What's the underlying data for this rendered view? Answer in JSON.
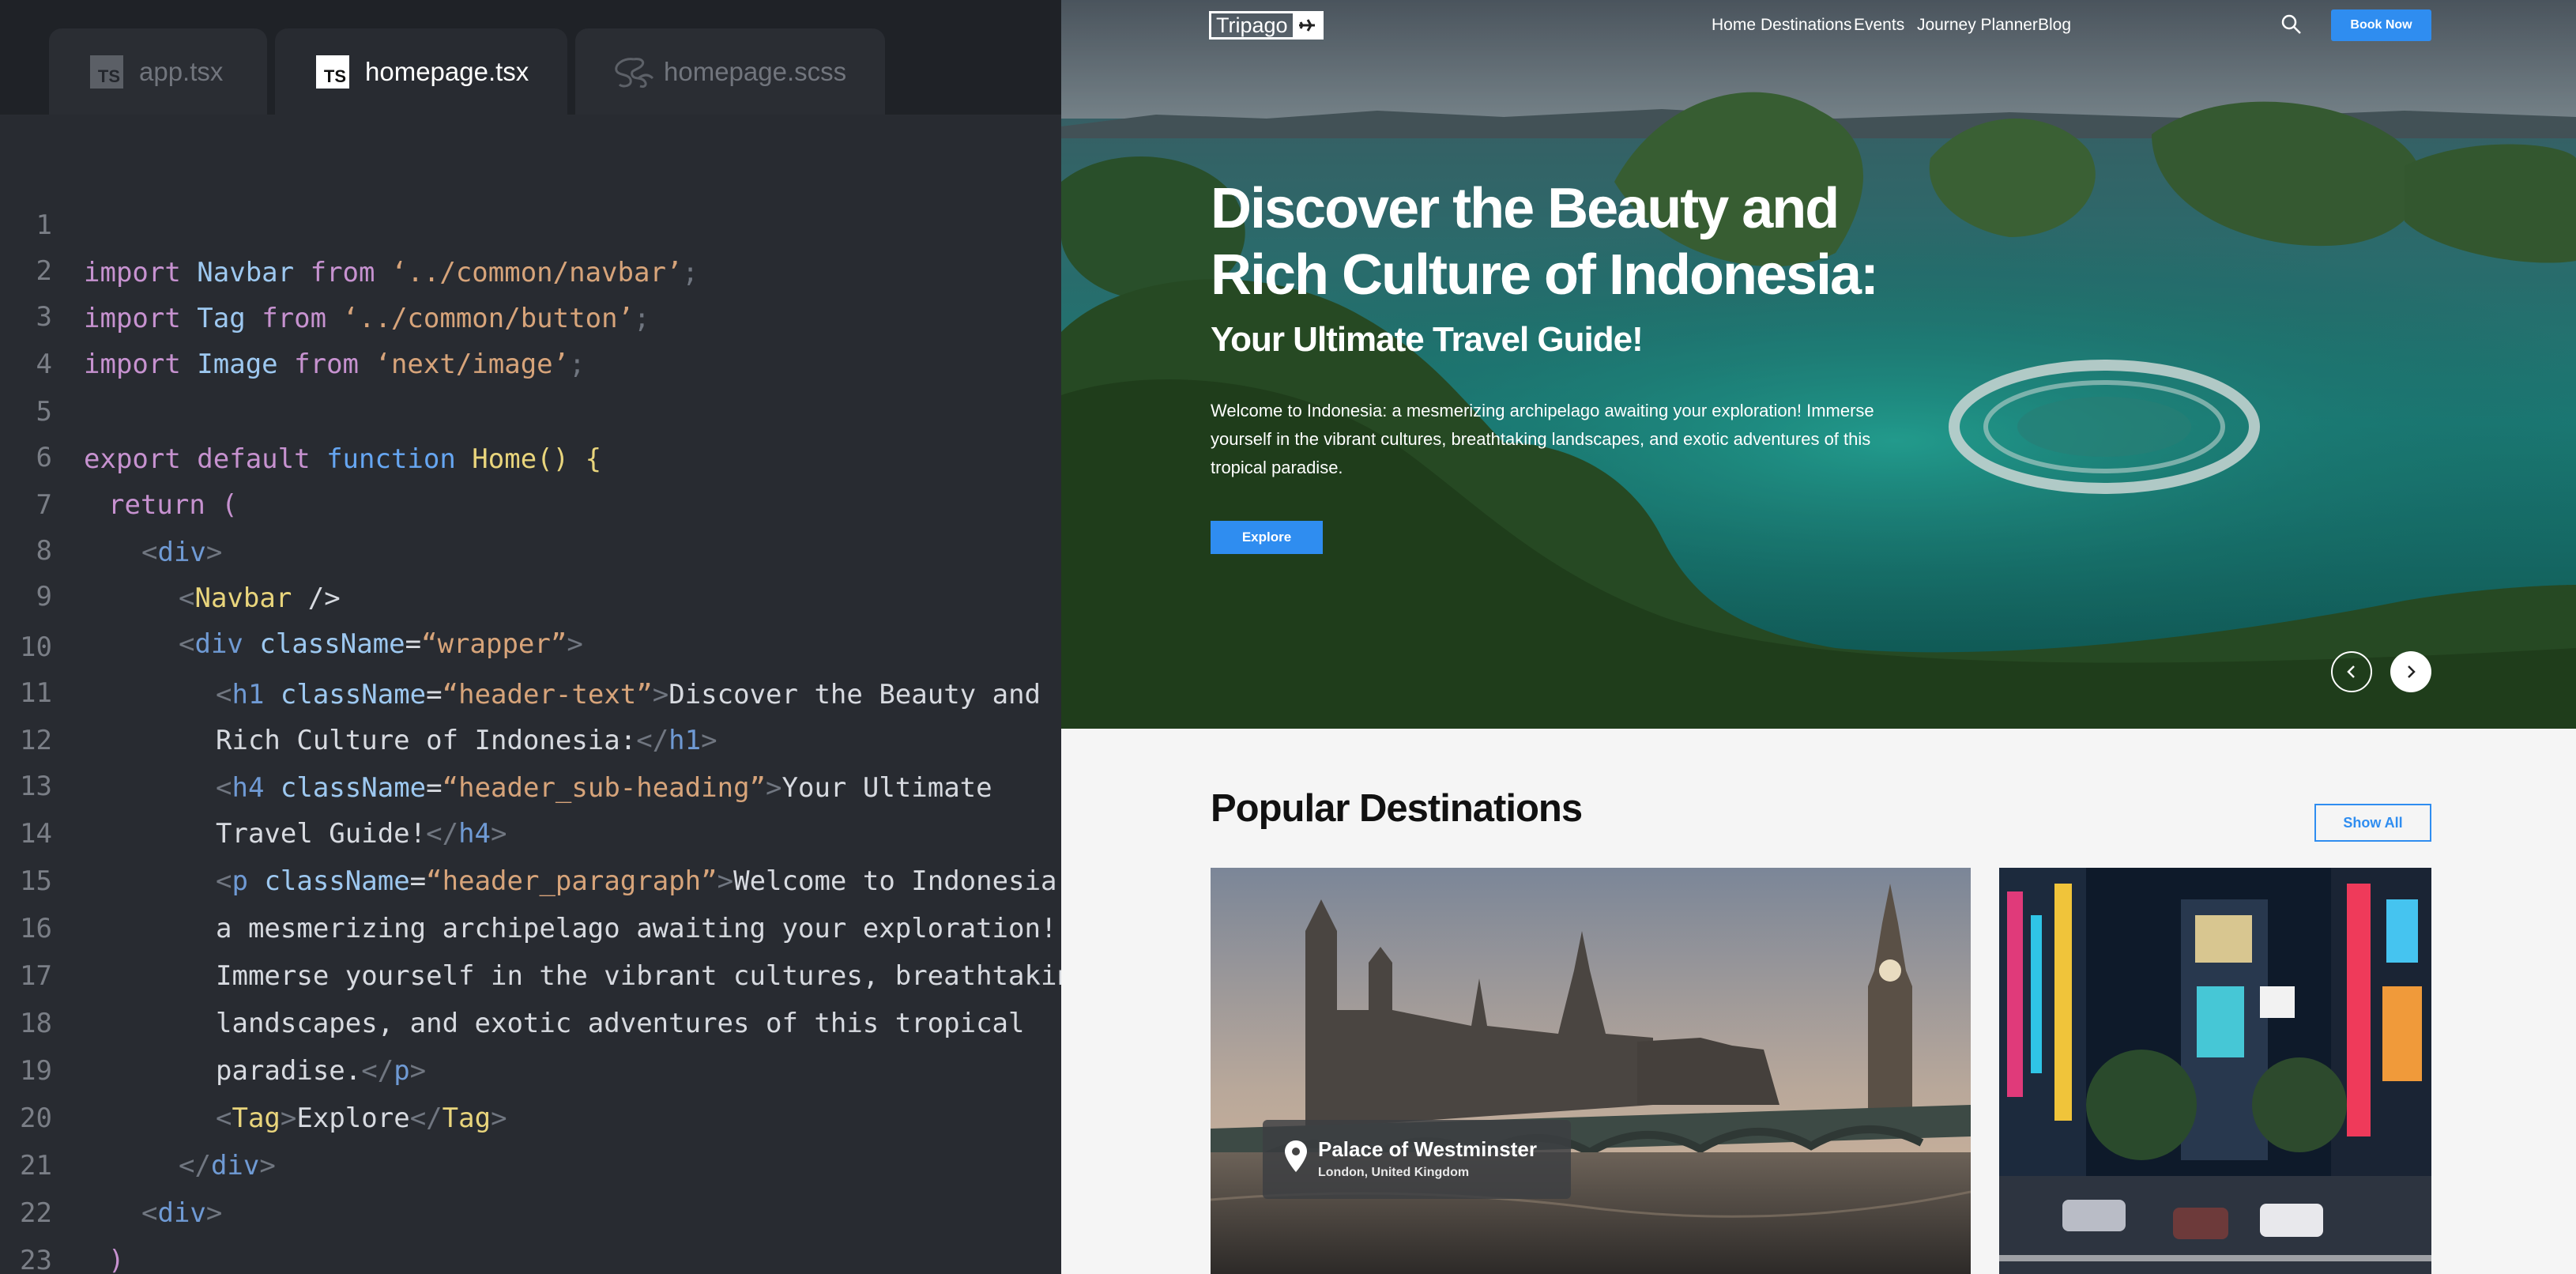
{
  "editor": {
    "tabs": [
      {
        "label": "app.tsx",
        "icon": "typescript-icon"
      },
      {
        "label": "homepage.tsx",
        "icon": "typescript-icon",
        "active": true
      },
      {
        "label": "homepage.scss",
        "icon": "sass-icon"
      }
    ],
    "ts_icon_text": "TS",
    "line_numbers": [
      "1",
      "2",
      "3",
      "4",
      "5",
      "6",
      "7",
      "8",
      "9",
      "10",
      "11",
      "12",
      "13",
      "14",
      "15",
      "16",
      "17",
      "18",
      "19",
      "20",
      "21",
      "22",
      "23"
    ],
    "code": {
      "l1": [
        "import",
        " Navbar ",
        "from",
        " ‘../common/navbar’",
        ";"
      ],
      "l2": [
        "import",
        " Tag ",
        "from",
        " ‘../common/button’",
        ";"
      ],
      "l3": [
        "import",
        " Image ",
        "from",
        " ‘next/image’",
        ";"
      ],
      "l5": [
        "export",
        " default ",
        "function",
        " Home",
        "()",
        " {"
      ],
      "l6": [
        "return",
        " ("
      ],
      "l7": [
        "<",
        "div",
        ">"
      ],
      "l8": [
        "<",
        "Navbar",
        " />"
      ],
      "l9": [
        "<",
        "div",
        " className",
        "=",
        "“wrapper”",
        ">"
      ],
      "l10": [
        "<",
        "h1",
        " className",
        "=",
        "“header-text”",
        ">",
        "Discover the Beauty and"
      ],
      "l11": [
        "Rich Culture of Indonesia:",
        "</",
        "h1",
        ">"
      ],
      "l12": [
        "<",
        "h4",
        " className",
        "=",
        "“header_sub-heading”",
        ">",
        "Your Ultimate"
      ],
      "l13": [
        "Travel Guide!",
        "</",
        "h4",
        ">"
      ],
      "l14": [
        "<",
        "p",
        " className",
        "=",
        "“header_paragraph”",
        ">",
        "Welcome to Indonesia:"
      ],
      "l15": [
        "a mesmerizing archipelago awaiting your exploration!"
      ],
      "l16": [
        "Immerse yourself in the vibrant cultures, breathtaking"
      ],
      "l17": [
        "landscapes, and exotic adventures of this tropical"
      ],
      "l18": [
        "paradise.",
        "</",
        "p",
        ">"
      ],
      "l19": [
        "<",
        "Tag",
        ">",
        "Explore",
        "</",
        "Tag",
        ">"
      ],
      "l20": [
        "</",
        "div",
        ">"
      ],
      "l21": [
        "<",
        "div",
        ">"
      ],
      "l22": [
        ")"
      ],
      "l23": [
        "}"
      ]
    }
  },
  "site": {
    "logo_text": "Tripago",
    "nav_links": [
      "Home",
      "Destinations",
      "Events",
      "Journey Planner",
      "Blog"
    ],
    "book_button": "Book Now",
    "hero_title": "Discover the Beauty and Rich Culture of Indonesia:",
    "hero_subtitle": "Your Ultimate Travel Guide!",
    "hero_paragraph": "Welcome to Indonesia: a mesmerizing archipelago awaiting your exploration! Immerse yourself in the vibrant cultures, breathtaking landscapes, and exotic adventures of this tropical paradise.",
    "explore_button": "Explore",
    "section_title": "Popular Destinations",
    "show_all": "Show All",
    "cards": [
      {
        "name": "Palace of Westminster",
        "location": "London, United Kingdom"
      }
    ],
    "colors": {
      "accent": "#2f8df0",
      "page_bg": "#f5f5f5",
      "editor_bg": "#282b31"
    }
  }
}
